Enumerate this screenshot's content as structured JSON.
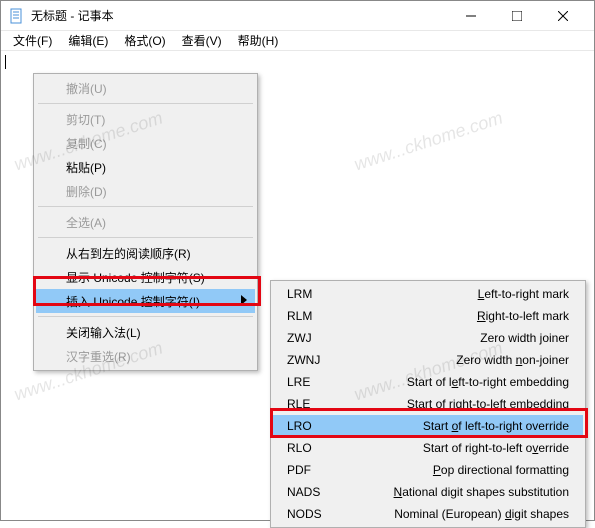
{
  "title": "无标题 - 记事本",
  "menubar": {
    "file": "文件(F)",
    "edit": "编辑(E)",
    "format": "格式(O)",
    "view": "查看(V)",
    "help": "帮助(H)"
  },
  "ctx": {
    "undo": "撤消(U)",
    "cut": "剪切(T)",
    "copy": "复制(C)",
    "paste": "粘贴(P)",
    "delete": "删除(D)",
    "selectall": "全选(A)",
    "rtl": "从右到左的阅读顺序(R)",
    "showuni": "显示 Unicode 控制字符(S)",
    "insuni": "插入 Unicode 控制字符(I)",
    "closeime": "关闭输入法(L)",
    "reconv": "汉字重选(R)"
  },
  "sub": [
    {
      "l": "LRM",
      "r": "Left-to-right mark",
      "u": "L"
    },
    {
      "l": "RLM",
      "r": "Right-to-left mark",
      "u": "R"
    },
    {
      "l": "ZWJ",
      "r": "Zero width joiner",
      "u": "j"
    },
    {
      "l": "ZWNJ",
      "r": "Zero width non-joiner",
      "u": "n"
    },
    {
      "l": "LRE",
      "r": "Start of left-to-right embedding",
      "u": "e"
    },
    {
      "l": "RLE",
      "r": "Start of right-to-left embedding",
      "u": "m"
    },
    {
      "l": "LRO",
      "r": "Start of left-to-right override",
      "u": "o",
      "hl": true
    },
    {
      "l": "RLO",
      "r": "Start of right-to-left override",
      "u": "v"
    },
    {
      "l": "PDF",
      "r": "Pop directional formatting",
      "u": "P"
    },
    {
      "l": "NADS",
      "r": "National digit shapes substitution",
      "u": "N"
    },
    {
      "l": "NODS",
      "r": "Nominal (European) digit shapes",
      "u": "d"
    }
  ],
  "watermark": "www...ckhome.com"
}
